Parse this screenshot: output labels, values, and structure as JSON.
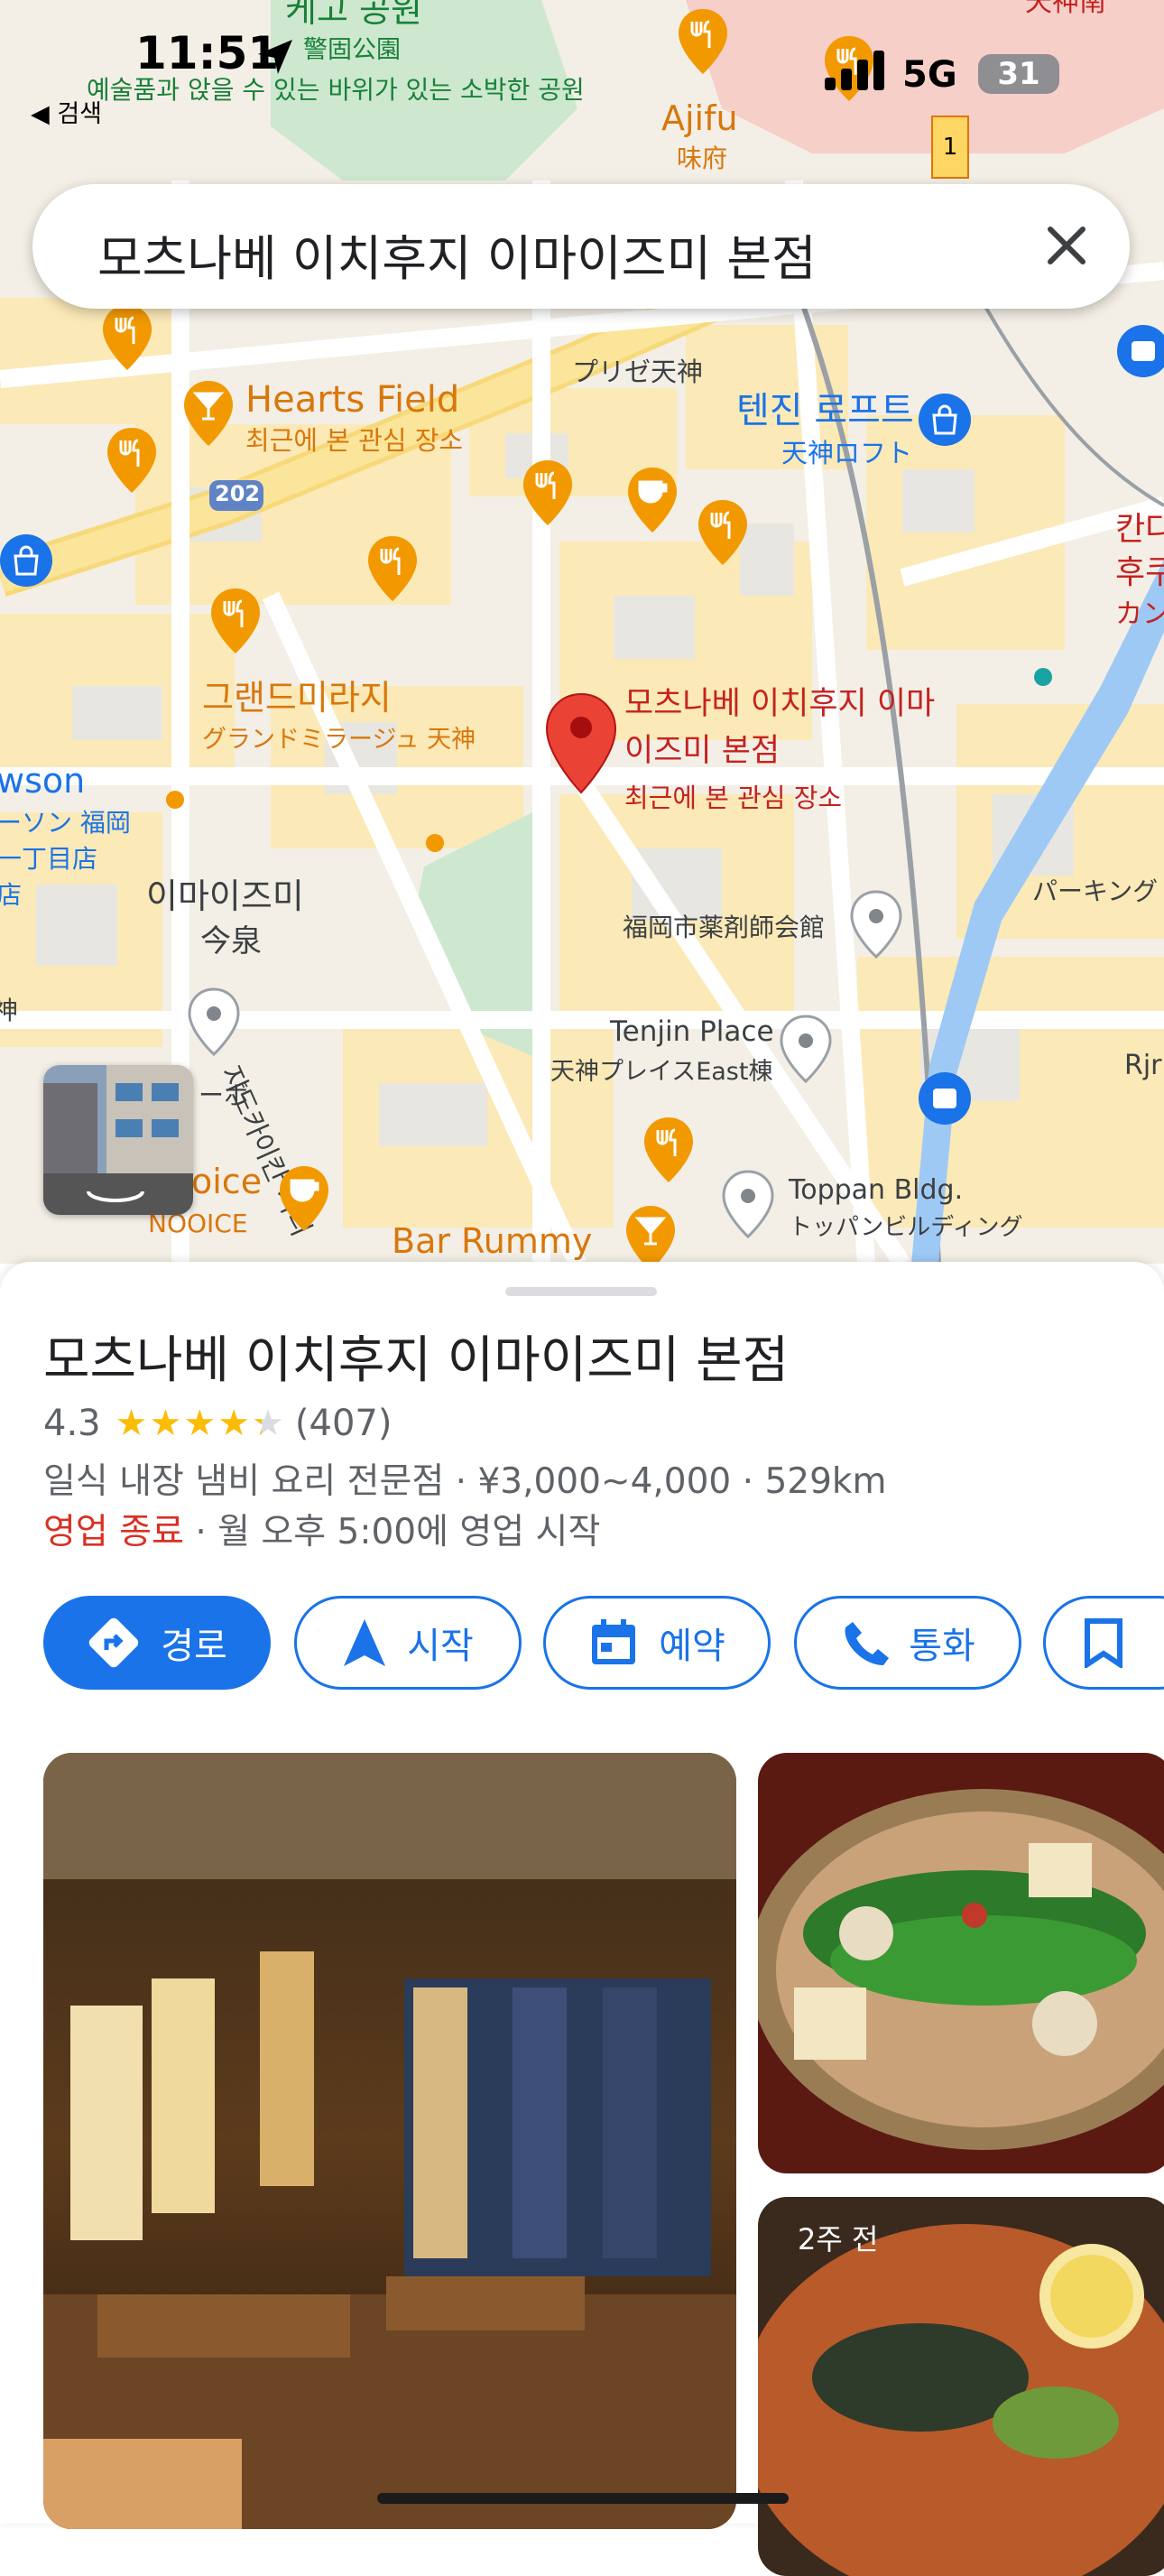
{
  "status": {
    "time": "11:51",
    "network": "5G",
    "battery": "31"
  },
  "back": {
    "label": "◀ 검색"
  },
  "search": {
    "query": "모츠나베 이치후지 이마이즈미 본점"
  },
  "map": {
    "labels": {
      "park_ko": "케고 공원",
      "park_jp": "警固公園",
      "park_desc": "예술품과 앉을 수 있는 바위가 있는 소박한 공원",
      "ajifu_en": "Ajifu",
      "ajifu_jp": "味府",
      "hearts_field": "Hearts Field",
      "hearts_sub": "최근에 본 관심 장소",
      "route_202": "202",
      "prize": "プリゼ天神",
      "tenjin_loft_ko": "텐진 로프트",
      "tenjin_loft_jp": "天神ロフト",
      "kanda_ko_1": "칸다",
      "kanda_ko_2": "후쿠",
      "kanda_jp": "カン",
      "grand_ko": "그랜드미라지",
      "grand_jp": "グランドミラージュ 天神",
      "place_line1": "모츠나베 이치후지 이마",
      "place_line2": "이즈미 본점",
      "place_sub": "최근에 본 관심 장소",
      "lawson_en": "wson",
      "lawson_jp1": "ーソン 福岡",
      "lawson_jp2": "一丁目店",
      "lawson_jp3": "店",
      "imaizumi_ko": "이마이즈미",
      "imaizumi_jp": "今泉",
      "pharma": "福岡市薬剤師会館",
      "parking": "パーキング",
      "tenjin_place_en": "Tenjin Place",
      "tenjin_place_jp": "天神プレイスEast棟",
      "rjr": "Rjr",
      "jin": "神",
      "bo": "ーボ",
      "street": "지도카이칸 거리",
      "noice_en": "oice",
      "noice_jp": "NOOICE",
      "toppan_en": "Toppan Bldg.",
      "toppan_jp": "トッパンビルディング",
      "bar_rummy": "Bar Rummy",
      "tenjin_minami": "天神南",
      "station_box": "1"
    }
  },
  "place": {
    "title": "모츠나베 이치후지 이마이즈미 본점",
    "rating": "4.3",
    "stars": 4.3,
    "reviews": "(407)",
    "info": "일식 내장 냄비 요리 전문점 · ¥3,000~4,000 · 529km",
    "closed": "영업 종료",
    "hours": " · 월 오후 5:00에 영업 시작",
    "photo_age": "2주 전"
  },
  "actions": {
    "route": "경로",
    "start": "시작",
    "reserve": "예약",
    "call": "통화"
  },
  "colors": {
    "accent": "#1a73e8",
    "closed": "#d93025",
    "pin": "#ea4335",
    "food": "#f29900"
  }
}
